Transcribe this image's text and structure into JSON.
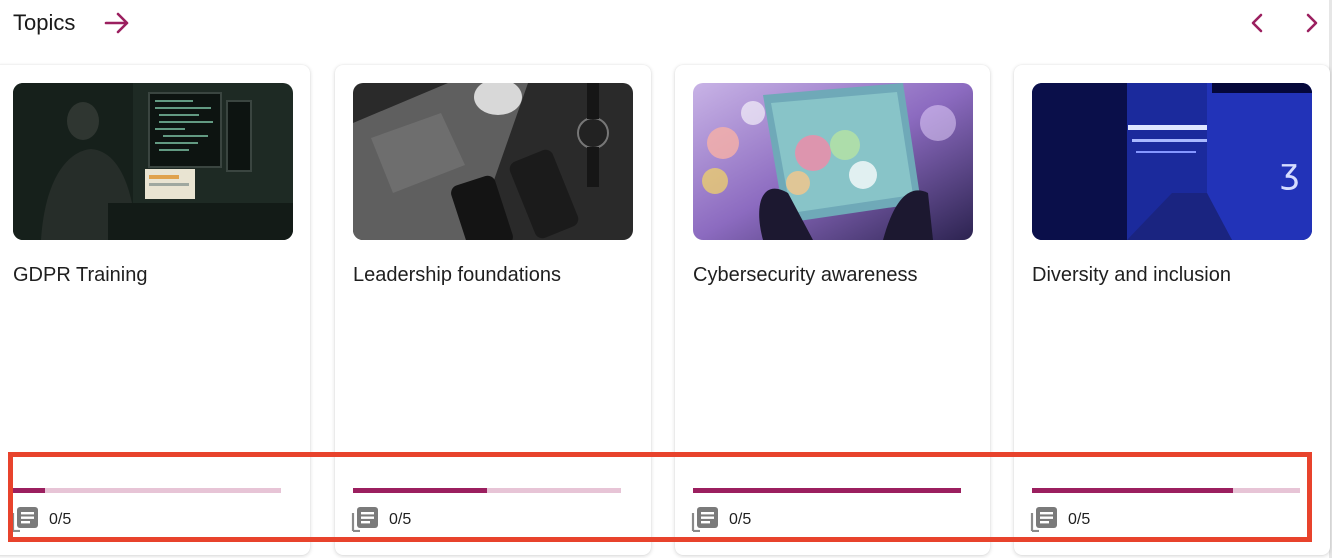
{
  "header": {
    "title": "Topics",
    "accent_color": "#9b1f5f",
    "arrow_icon": "arrow-right-icon",
    "prev_icon": "chevron-left-icon",
    "next_icon": "chevron-right-icon"
  },
  "cards": [
    {
      "title": "GDPR Training",
      "progress": 0.12,
      "count": "0/5",
      "image": "developer-at-monitors-photo"
    },
    {
      "title": "Leadership foundations",
      "progress": 0.5,
      "count": "0/5",
      "image": "laptop-and-phones-photo"
    },
    {
      "title": "Cybersecurity awareness",
      "progress": 1.0,
      "count": "0/5",
      "image": "hand-holding-phone-bokeh-photo"
    },
    {
      "title": "Diversity and inclusion",
      "progress": 0.75,
      "count": "0/5",
      "image": "blue-corridor-photo"
    }
  ],
  "colors": {
    "progress_fill": "#9b1f5f",
    "progress_track": "#e7c4d6",
    "highlight": "#e8432c"
  }
}
